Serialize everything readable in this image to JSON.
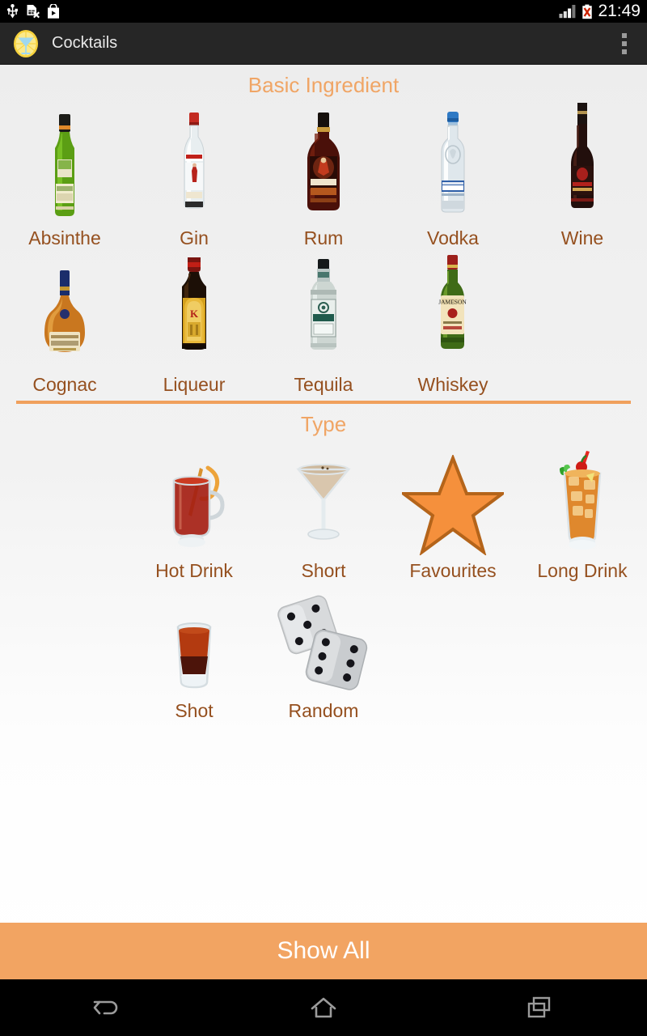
{
  "status_bar": {
    "icons": [
      "usb-icon",
      "sim-card-missing-icon",
      "play-store-icon"
    ],
    "signal_icon": "signal-bars-icon",
    "battery_icon": "battery-error-icon",
    "time": "21:49"
  },
  "action_bar": {
    "app_icon": "cocktail-lemon-icon",
    "title": "Cocktails",
    "overflow_icon": "overflow-menu-icon"
  },
  "sections": [
    {
      "title": "Basic Ingredient",
      "items": [
        {
          "label": "Absinthe",
          "icon": "absinthe-bottle-icon"
        },
        {
          "label": "Gin",
          "icon": "gin-bottle-icon"
        },
        {
          "label": "Rum",
          "icon": "rum-bottle-icon"
        },
        {
          "label": "Vodka",
          "icon": "vodka-bottle-icon"
        },
        {
          "label": "Wine",
          "icon": "wine-bottle-icon"
        },
        {
          "label": "Cognac",
          "icon": "cognac-bottle-icon"
        },
        {
          "label": "Liqueur",
          "icon": "liqueur-bottle-icon"
        },
        {
          "label": "Tequila",
          "icon": "tequila-bottle-icon"
        },
        {
          "label": "Whiskey",
          "icon": "whiskey-bottle-icon"
        }
      ]
    },
    {
      "title": "Type",
      "items": [
        {
          "label": "Hot Drink",
          "icon": "hot-drink-glass-icon"
        },
        {
          "label": "Short",
          "icon": "martini-glass-icon"
        },
        {
          "label": "Favourites",
          "icon": "star-icon"
        },
        {
          "label": "Long Drink",
          "icon": "highball-glass-icon"
        },
        {
          "label": "Shot",
          "icon": "shot-glass-icon"
        },
        {
          "label": "Random",
          "icon": "dice-icon"
        }
      ]
    }
  ],
  "show_all_button": {
    "label": "Show All"
  },
  "nav_bar": {
    "back": "back-icon",
    "home": "home-icon",
    "recents": "recents-icon"
  },
  "colors": {
    "accent_orange": "#f0a05c",
    "header_orange": "#f0a565",
    "label_brown": "#95501f",
    "action_bar": "#262626",
    "star_fill": "#f5903c",
    "star_stroke": "#b4641a"
  }
}
